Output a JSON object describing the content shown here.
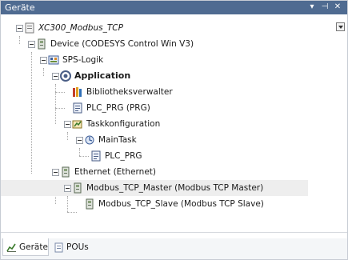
{
  "panel": {
    "title": "Geräte",
    "controls": {
      "menu": "▾",
      "pin": "⊣",
      "close": "✕"
    }
  },
  "tree": {
    "project": "XC300_Modbus_TCP",
    "device": "Device (CODESYS Control Win V3)",
    "plc_logic": "SPS-Logik",
    "application": "Application",
    "library_manager": "Bibliotheksverwalter",
    "plc_prg": "PLC_PRG (PRG)",
    "task_config": "Taskkonfiguration",
    "main_task": "MainTask",
    "main_task_prg": "PLC_PRG",
    "ethernet": "Ethernet (Ethernet)",
    "modbus_master": "Modbus_TCP_Master (Modbus TCP Master)",
    "modbus_slave": "Modbus_TCP_Slave (Modbus TCP Slave)"
  },
  "tabs": {
    "devices": "Geräte",
    "pous": "POUs"
  },
  "colors": {
    "titlebar": "#4f6b91",
    "selected_row": "#eeeeee"
  }
}
